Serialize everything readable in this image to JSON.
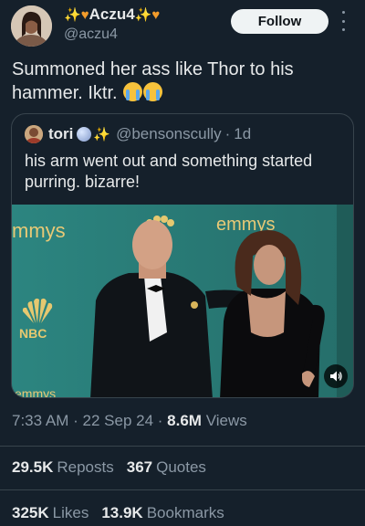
{
  "author": {
    "display_name": "Aczu4",
    "handle": "@aczu4",
    "avatar_icon": "profile-photo",
    "name_emoji": [
      "sparkles",
      "orange-heart",
      "sparkles",
      "orange-heart"
    ]
  },
  "follow_label": "Follow",
  "tweet": {
    "text": "Summoned her ass like Thor to his hammer. Iktr.",
    "trailing_emoji": [
      "loudly-crying-face",
      "loudly-crying-face"
    ]
  },
  "quoted": {
    "display_name": "tori",
    "handle": "@bensonscully",
    "age": "1d",
    "separator": "·",
    "text": "his arm went out and something started purring. bizarre!",
    "media": {
      "type": "video",
      "backdrop_text_left": "mmys",
      "backdrop_text_right": "emmys",
      "backdrop_text_bottom": "emmys",
      "logo_text": "NBC",
      "volume_icon": "speaker-icon"
    }
  },
  "meta": {
    "time": "7:33 AM",
    "date": "22 Sep 24",
    "separator": "·",
    "views_count": "8.6M",
    "views_label": "Views"
  },
  "stats": {
    "reposts_count": "29.5K",
    "reposts_label": "Reposts",
    "quotes_count": "367",
    "quotes_label": "Quotes",
    "likes_count": "325K",
    "likes_label": "Likes",
    "bookmarks_count": "13.9K",
    "bookmarks_label": "Bookmarks"
  },
  "colors": {
    "background": "#15202b",
    "text": "#e7e9ea",
    "secondary_text": "#8b98a5",
    "border": "#38444d",
    "media_backdrop": "#2b7d78"
  }
}
